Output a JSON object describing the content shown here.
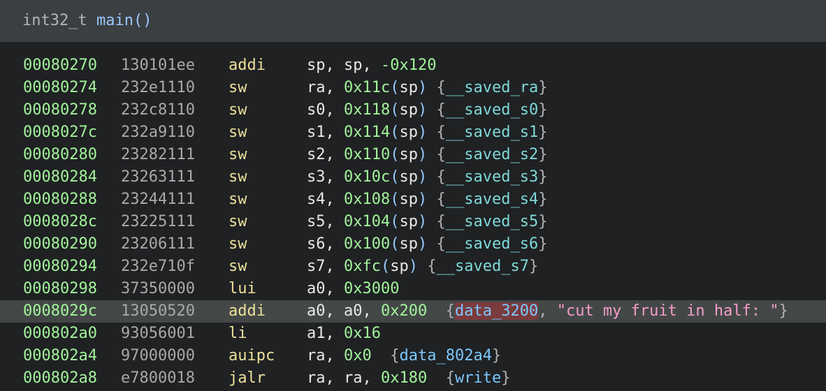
{
  "header": {
    "return_type": "int32_t",
    "function_name": "main",
    "parens": "()"
  },
  "rows": [
    {
      "addr": "00080270",
      "bytes": "130101ee",
      "mnem": "addi",
      "tokens": [
        [
          "reg",
          "sp"
        ],
        [
          "pun",
          ", "
        ],
        [
          "reg",
          "sp"
        ],
        [
          "pun",
          ", "
        ],
        [
          "imm",
          "-0x120"
        ]
      ]
    },
    {
      "addr": "00080274",
      "bytes": "232e1110",
      "mnem": "sw",
      "tokens": [
        [
          "reg",
          "ra"
        ],
        [
          "pun",
          ", "
        ],
        [
          "imm",
          "0x11c"
        ],
        [
          "paren",
          "("
        ],
        [
          "reg",
          "sp"
        ],
        [
          "paren",
          ")"
        ],
        [
          "pun",
          " "
        ],
        [
          "brace",
          "{"
        ],
        [
          "var",
          "__saved_ra"
        ],
        [
          "brace",
          "}"
        ]
      ]
    },
    {
      "addr": "00080278",
      "bytes": "232c8110",
      "mnem": "sw",
      "tokens": [
        [
          "reg",
          "s0"
        ],
        [
          "pun",
          ", "
        ],
        [
          "imm",
          "0x118"
        ],
        [
          "paren",
          "("
        ],
        [
          "reg",
          "sp"
        ],
        [
          "paren",
          ")"
        ],
        [
          "pun",
          " "
        ],
        [
          "brace",
          "{"
        ],
        [
          "var",
          "__saved_s0"
        ],
        [
          "brace",
          "}"
        ]
      ]
    },
    {
      "addr": "0008027c",
      "bytes": "232a9110",
      "mnem": "sw",
      "tokens": [
        [
          "reg",
          "s1"
        ],
        [
          "pun",
          ", "
        ],
        [
          "imm",
          "0x114"
        ],
        [
          "paren",
          "("
        ],
        [
          "reg",
          "sp"
        ],
        [
          "paren",
          ")"
        ],
        [
          "pun",
          " "
        ],
        [
          "brace",
          "{"
        ],
        [
          "var",
          "__saved_s1"
        ],
        [
          "brace",
          "}"
        ]
      ]
    },
    {
      "addr": "00080280",
      "bytes": "23282111",
      "mnem": "sw",
      "tokens": [
        [
          "reg",
          "s2"
        ],
        [
          "pun",
          ", "
        ],
        [
          "imm",
          "0x110"
        ],
        [
          "paren",
          "("
        ],
        [
          "reg",
          "sp"
        ],
        [
          "paren",
          ")"
        ],
        [
          "pun",
          " "
        ],
        [
          "brace",
          "{"
        ],
        [
          "var",
          "__saved_s2"
        ],
        [
          "brace",
          "}"
        ]
      ]
    },
    {
      "addr": "00080284",
      "bytes": "23263111",
      "mnem": "sw",
      "tokens": [
        [
          "reg",
          "s3"
        ],
        [
          "pun",
          ", "
        ],
        [
          "imm",
          "0x10c"
        ],
        [
          "paren",
          "("
        ],
        [
          "reg",
          "sp"
        ],
        [
          "paren",
          ")"
        ],
        [
          "pun",
          " "
        ],
        [
          "brace",
          "{"
        ],
        [
          "var",
          "__saved_s3"
        ],
        [
          "brace",
          "}"
        ]
      ]
    },
    {
      "addr": "00080288",
      "bytes": "23244111",
      "mnem": "sw",
      "tokens": [
        [
          "reg",
          "s4"
        ],
        [
          "pun",
          ", "
        ],
        [
          "imm",
          "0x108"
        ],
        [
          "paren",
          "("
        ],
        [
          "reg",
          "sp"
        ],
        [
          "paren",
          ")"
        ],
        [
          "pun",
          " "
        ],
        [
          "brace",
          "{"
        ],
        [
          "var",
          "__saved_s4"
        ],
        [
          "brace",
          "}"
        ]
      ]
    },
    {
      "addr": "0008028c",
      "bytes": "23225111",
      "mnem": "sw",
      "tokens": [
        [
          "reg",
          "s5"
        ],
        [
          "pun",
          ", "
        ],
        [
          "imm",
          "0x104"
        ],
        [
          "paren",
          "("
        ],
        [
          "reg",
          "sp"
        ],
        [
          "paren",
          ")"
        ],
        [
          "pun",
          " "
        ],
        [
          "brace",
          "{"
        ],
        [
          "var",
          "__saved_s5"
        ],
        [
          "brace",
          "}"
        ]
      ]
    },
    {
      "addr": "00080290",
      "bytes": "23206111",
      "mnem": "sw",
      "tokens": [
        [
          "reg",
          "s6"
        ],
        [
          "pun",
          ", "
        ],
        [
          "imm",
          "0x100"
        ],
        [
          "paren",
          "("
        ],
        [
          "reg",
          "sp"
        ],
        [
          "paren",
          ")"
        ],
        [
          "pun",
          " "
        ],
        [
          "brace",
          "{"
        ],
        [
          "var",
          "__saved_s6"
        ],
        [
          "brace",
          "}"
        ]
      ]
    },
    {
      "addr": "00080294",
      "bytes": "232e710f",
      "mnem": "sw",
      "tokens": [
        [
          "reg",
          "s7"
        ],
        [
          "pun",
          ", "
        ],
        [
          "imm",
          "0xfc"
        ],
        [
          "paren",
          "("
        ],
        [
          "reg",
          "sp"
        ],
        [
          "paren",
          ")"
        ],
        [
          "pun",
          " "
        ],
        [
          "brace",
          "{"
        ],
        [
          "var",
          "__saved_s7"
        ],
        [
          "brace",
          "}"
        ]
      ]
    },
    {
      "addr": "00080298",
      "bytes": "37350000",
      "mnem": "lui",
      "tokens": [
        [
          "reg",
          "a0"
        ],
        [
          "pun",
          ", "
        ],
        [
          "imm",
          "0x3000"
        ]
      ]
    },
    {
      "addr": "0008029c",
      "bytes": "13050520",
      "mnem": "addi",
      "selected": true,
      "tokens": [
        [
          "reg",
          "a0"
        ],
        [
          "pun",
          ", "
        ],
        [
          "reg",
          "a0"
        ],
        [
          "pun",
          ", "
        ],
        [
          "imm",
          "0x200"
        ],
        [
          "pun",
          "  "
        ],
        [
          "brace",
          "{"
        ],
        [
          "symhl",
          "data_3200"
        ],
        [
          "brace",
          ", "
        ],
        [
          "str",
          "\"cut my fruit in half: \""
        ],
        [
          "brace",
          "}"
        ]
      ]
    },
    {
      "addr": "000802a0",
      "bytes": "93056001",
      "mnem": "li",
      "tokens": [
        [
          "reg",
          "a1"
        ],
        [
          "pun",
          ", "
        ],
        [
          "imm",
          "0x16"
        ]
      ]
    },
    {
      "addr": "000802a4",
      "bytes": "97000000",
      "mnem": "auipc",
      "tokens": [
        [
          "reg",
          "ra"
        ],
        [
          "pun",
          ", "
        ],
        [
          "imm",
          "0x0"
        ],
        [
          "pun",
          "  "
        ],
        [
          "brace",
          "{"
        ],
        [
          "sym",
          "data_802a4"
        ],
        [
          "brace",
          "}"
        ]
      ]
    },
    {
      "addr": "000802a8",
      "bytes": "e7800018",
      "mnem": "jalr",
      "tokens": [
        [
          "reg",
          "ra"
        ],
        [
          "pun",
          ", "
        ],
        [
          "reg",
          "ra"
        ],
        [
          "pun",
          ", "
        ],
        [
          "imm",
          "0x180"
        ],
        [
          "pun",
          "  "
        ],
        [
          "brace",
          "{"
        ],
        [
          "sym",
          "write"
        ],
        [
          "brace",
          "}"
        ]
      ]
    }
  ]
}
